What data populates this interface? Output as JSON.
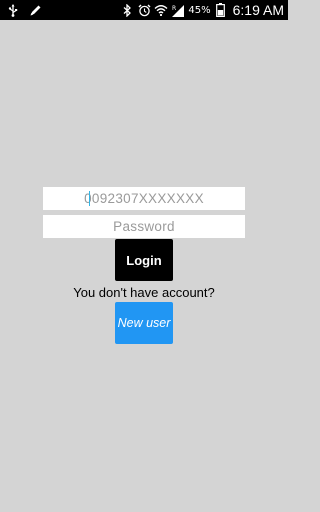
{
  "status_bar": {
    "battery_percent": "45%",
    "time": "6:19 AM",
    "icons_left": [
      "usb-icon",
      "pencil-icon"
    ],
    "icons_right": [
      "bluetooth-icon",
      "alarm-icon",
      "wifi-icon",
      "signal-icon",
      "battery-icon"
    ]
  },
  "login_form": {
    "phone_placeholder": "0092307XXXXXXX",
    "phone_value": "",
    "password_placeholder": "Password",
    "password_value": "",
    "login_label": "Login",
    "no_account_text": "You don't have account?",
    "new_user_label": "New user"
  },
  "colors": {
    "background": "#d4d4d4",
    "status_bar": "#000000",
    "login_button": "#000000",
    "new_user_button": "#2196f3",
    "caret": "#33b5e5"
  }
}
